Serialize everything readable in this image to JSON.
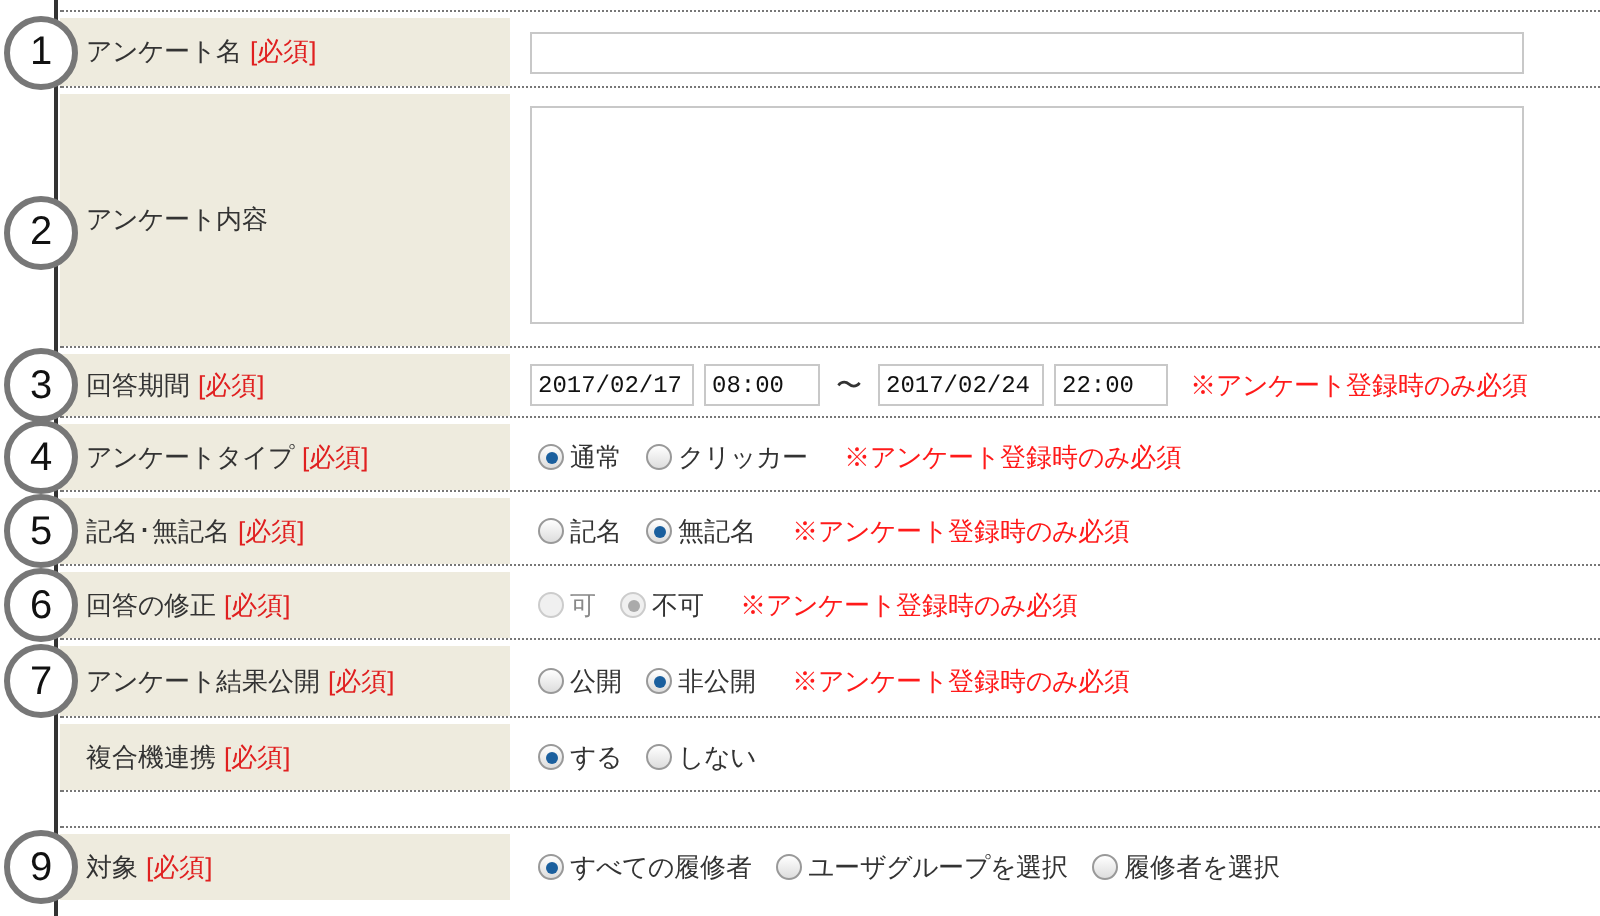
{
  "rows": [
    {
      "kind": "text",
      "callout": "1",
      "label": "アンケート名",
      "required": "[必須]"
    },
    {
      "kind": "textarea",
      "callout": "2",
      "label": "アンケート内容"
    },
    {
      "kind": "period",
      "callout": "3",
      "label": "回答期間",
      "required": "[必須]",
      "start_date": "2017/02/17",
      "start_time": "08:00",
      "separator": "〜",
      "end_date": "2017/02/24",
      "end_time": "22:00",
      "note": "※アンケート登録時のみ必須"
    },
    {
      "kind": "radio",
      "callout": "4",
      "label": "アンケートタイプ",
      "required": "[必須]",
      "options": [
        {
          "label": "通常",
          "selected": true,
          "disabled": false
        },
        {
          "label": "クリッカー",
          "selected": false,
          "disabled": false
        }
      ],
      "note": "※アンケート登録時のみ必須"
    },
    {
      "kind": "radio",
      "callout": "5",
      "label": "記名･無記名",
      "required": "[必須]",
      "options": [
        {
          "label": "記名",
          "selected": false,
          "disabled": false
        },
        {
          "label": "無記名",
          "selected": true,
          "disabled": false
        }
      ],
      "note": "※アンケート登録時のみ必須"
    },
    {
      "kind": "radio",
      "callout": "6",
      "label": "回答の修正",
      "required": "[必須]",
      "options": [
        {
          "label": "可",
          "selected": false,
          "disabled": true
        },
        {
          "label": "不可",
          "selected": true,
          "disabled": true
        }
      ],
      "note": "※アンケート登録時のみ必須"
    },
    {
      "kind": "radio",
      "callout": "7",
      "label": "アンケート結果公開",
      "required": "[必須]",
      "options": [
        {
          "label": "公開",
          "selected": false,
          "disabled": false
        },
        {
          "label": "非公開",
          "selected": true,
          "disabled": false
        }
      ],
      "note": "※アンケート登録時のみ必須"
    },
    {
      "kind": "radio",
      "label": "複合機連携",
      "required": "[必須]",
      "options": [
        {
          "label": "する",
          "selected": true,
          "disabled": false
        },
        {
          "label": "しない",
          "selected": false,
          "disabled": false
        }
      ]
    },
    {
      "kind": "spacer"
    },
    {
      "kind": "radio",
      "callout": "9",
      "label": "対象",
      "required": "[必須]",
      "options": [
        {
          "label": "すべての履修者",
          "selected": true,
          "disabled": false
        },
        {
          "label": "ユーザグループを選択",
          "selected": false,
          "disabled": false
        },
        {
          "label": "履修者を選択",
          "selected": false,
          "disabled": false
        }
      ]
    }
  ]
}
